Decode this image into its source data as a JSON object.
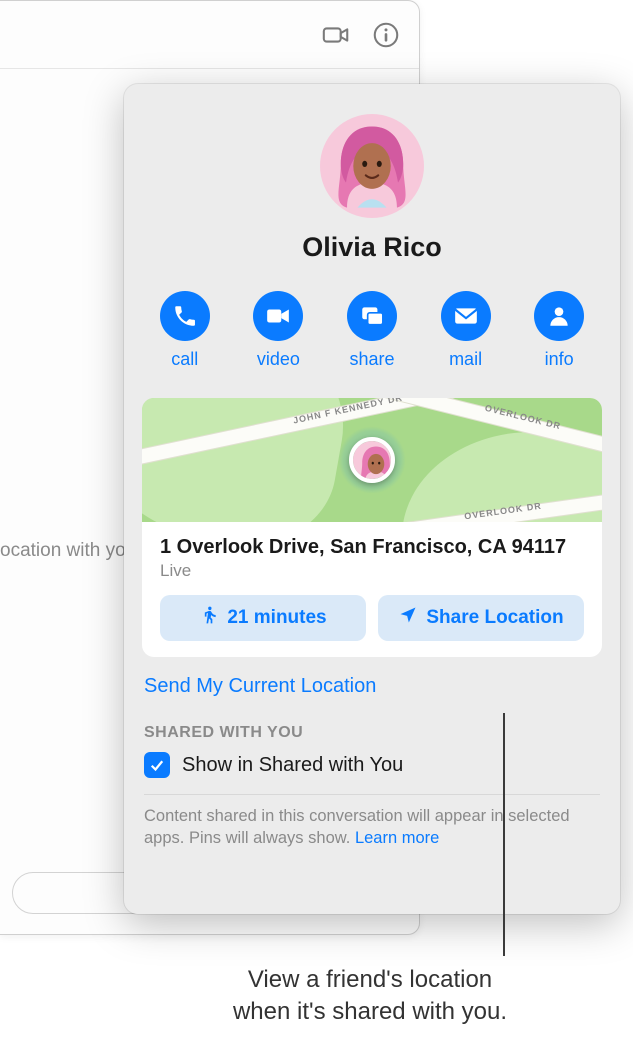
{
  "background": {
    "partial_text": "ocation with you"
  },
  "contact": {
    "name": "Olivia Rico"
  },
  "actions": {
    "call": "call",
    "video": "video",
    "share": "share",
    "mail": "mail",
    "info": "info"
  },
  "location": {
    "address": "1 Overlook Drive, San Francisco, CA 94117",
    "status": "Live",
    "walk_time": "21 minutes",
    "share_button": "Share Location",
    "streets": {
      "s1": "John F Kennedy Dr",
      "s2": "Overlook Dr",
      "s3": "Overlook Dr"
    }
  },
  "links": {
    "send_current": "Send My Current Location"
  },
  "shared_section": {
    "heading": "Shared with You",
    "checkbox_label": "Show in Shared with You",
    "footnote_a": "Content shared in this conversation will appear in selected apps. Pins will always show. ",
    "learn_more": "Learn more"
  },
  "callout": {
    "line1": "View a friend's location",
    "line2": "when it's shared with you."
  }
}
